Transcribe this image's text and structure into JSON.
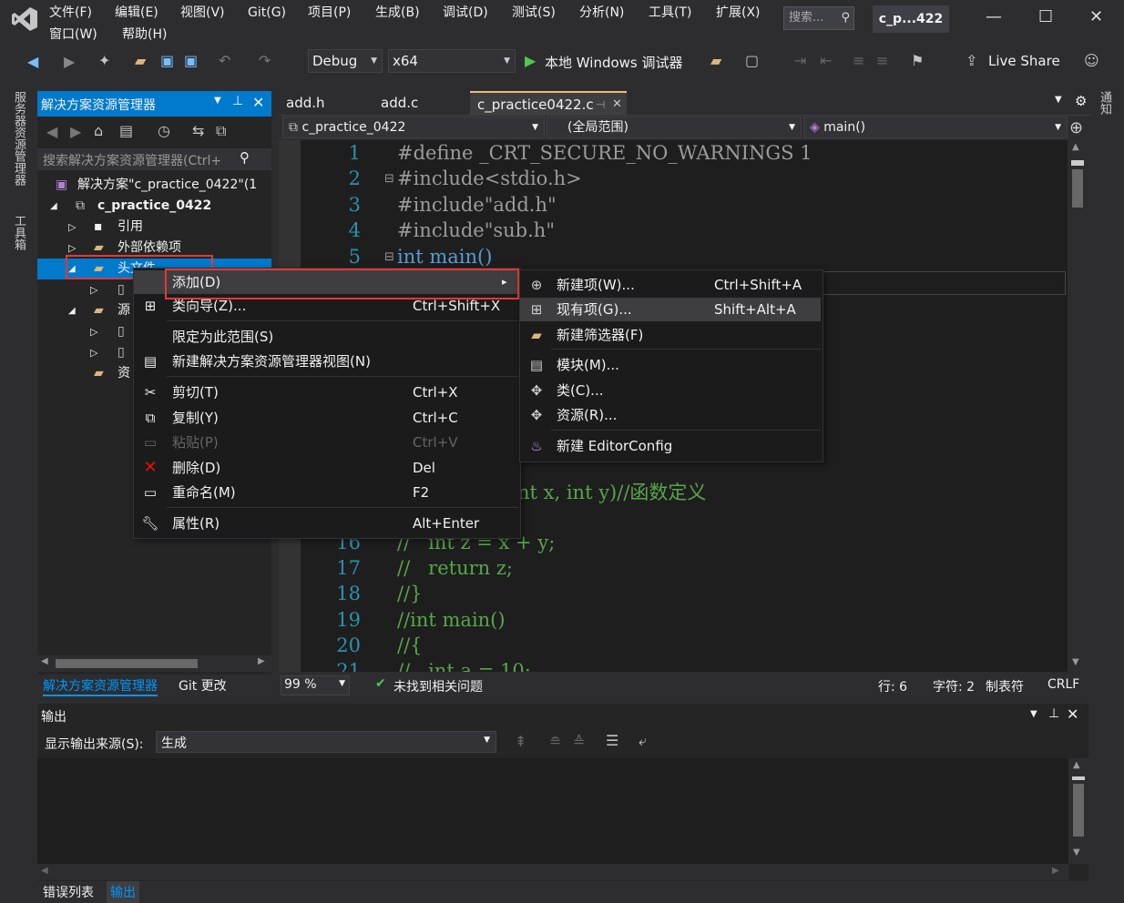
{
  "menubar": {
    "row1": [
      "文件(F)",
      "编辑(E)",
      "视图(V)",
      "Git(G)",
      "项目(P)",
      "生成(B)",
      "调试(D)",
      "测试(S)",
      "分析(N)",
      "工具(T)",
      "扩展(X)"
    ],
    "row2": [
      "窗口(W)",
      "帮助(H)"
    ],
    "search_placeholder": "搜索...",
    "title": "c_p...422"
  },
  "toolbar": {
    "config": "Debug",
    "platform": "x64",
    "run_label": "本地 Windows 调试器",
    "live_share": "Live Share"
  },
  "side_tabs": {
    "left1": "服务器资源管理器",
    "left2": "工具箱",
    "right1": "通知"
  },
  "solution_explorer": {
    "title": "解决方案资源管理器",
    "search_placeholder": "搜索解决方案资源管理器(Ctrl+",
    "solution": "解决方案\"c_practice_0422\"(1",
    "project": "c_practice_0422",
    "references": "引用",
    "external_deps": "外部依赖项",
    "header_files": "头文件",
    "source_files": "源",
    "resource_files": "资",
    "bottom_tab_active": "解决方案资源管理器",
    "bottom_tab_git": "Git 更改"
  },
  "editor": {
    "tabs": [
      "add.h",
      "add.c",
      "c_practice0422.c"
    ],
    "nav_project": "c_practice_0422",
    "nav_scope": "(全局范围)",
    "nav_function": "main()",
    "lines": [
      {
        "n": "1",
        "text": "#define _CRT_SECURE_NO_WARNINGS 1"
      },
      {
        "n": "2",
        "text": "#include<stdio.h>"
      },
      {
        "n": "3",
        "text": "#include\"add.h\""
      },
      {
        "n": "4",
        "text": "#include\"sub.h\""
      },
      {
        "n": "5",
        "text": "int main()"
      },
      {
        "n": "16",
        "text": "//   int z = x + y;"
      },
      {
        "n": "17",
        "text": "//   return z;"
      },
      {
        "n": "18",
        "text": "//}"
      },
      {
        "n": "19",
        "text": "//int main()"
      },
      {
        "n": "20",
        "text": "//{"
      },
      {
        "n": "21",
        "text": "//   int a = 10;"
      }
    ],
    "partial_line": "nt x, int y)//函数定义"
  },
  "context_menu": {
    "items": [
      {
        "label": "添加(D)",
        "shortcut": "",
        "arrow": "▸"
      },
      {
        "label": "类向导(Z)...",
        "shortcut": "Ctrl+Shift+X"
      },
      {
        "label": "限定为此范围(S)",
        "shortcut": ""
      },
      {
        "label": "新建解决方案资源管理器视图(N)",
        "shortcut": ""
      },
      {
        "label": "剪切(T)",
        "shortcut": "Ctrl+X"
      },
      {
        "label": "复制(Y)",
        "shortcut": "Ctrl+C"
      },
      {
        "label": "粘贴(P)",
        "shortcut": "Ctrl+V"
      },
      {
        "label": "删除(D)",
        "shortcut": "Del"
      },
      {
        "label": "重命名(M)",
        "shortcut": "F2"
      },
      {
        "label": "属性(R)",
        "shortcut": "Alt+Enter"
      }
    ]
  },
  "submenu": {
    "items": [
      {
        "label": "新建项(W)...",
        "shortcut": "Ctrl+Shift+A"
      },
      {
        "label": "现有项(G)...",
        "shortcut": "Shift+Alt+A"
      },
      {
        "label": "新建筛选器(F)",
        "shortcut": ""
      },
      {
        "label": "模块(M)...",
        "shortcut": ""
      },
      {
        "label": "类(C)...",
        "shortcut": ""
      },
      {
        "label": "资源(R)...",
        "shortcut": ""
      },
      {
        "label": "新建 EditorConfig",
        "shortcut": ""
      }
    ]
  },
  "statusbar": {
    "zoom": "99 %",
    "issues": "未找到相关问题",
    "line": "行: 6",
    "char": "字符: 2",
    "tabs": "制表符",
    "eol": "CRLF"
  },
  "output": {
    "title": "输出",
    "source_label": "显示输出来源(S):",
    "source_value": "生成",
    "bottom_tabs": [
      "错误列表",
      "输出"
    ]
  }
}
